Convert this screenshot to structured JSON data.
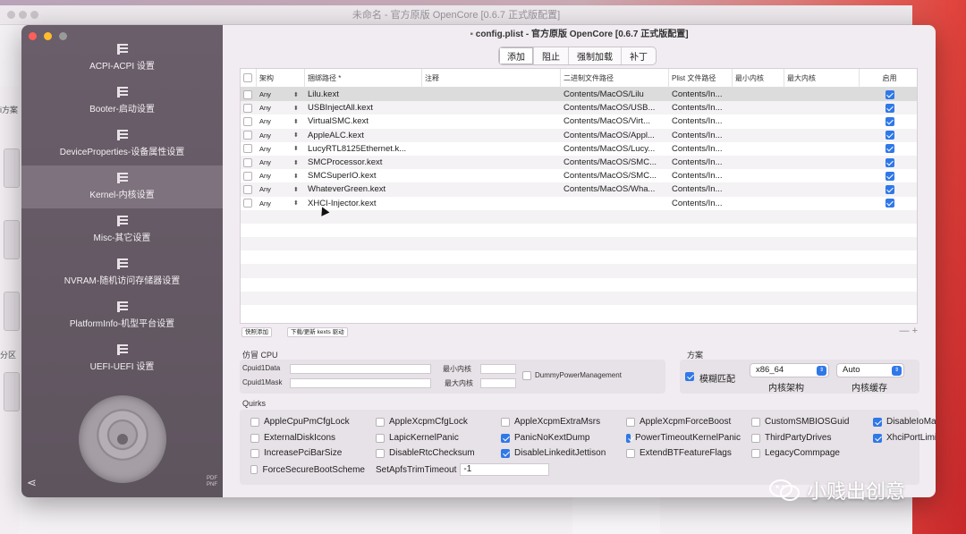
{
  "background_window": {
    "title": "未命名 - 官方原版 OpenCore [0.6.7 正式版配置]",
    "left_labels": [
      "i方案",
      "分区"
    ]
  },
  "window": {
    "title": "config.plist - 官方原版 OpenCore [0.6.7 正式版配置]"
  },
  "sidebar": {
    "items": [
      {
        "label": "ACPI-ACPI 设置"
      },
      {
        "label": "Booter-启动设置"
      },
      {
        "label": "DeviceProperties-设备属性设置"
      },
      {
        "label": "Kernel-内核设置",
        "active": true
      },
      {
        "label": "Misc-其它设置"
      },
      {
        "label": "NVRAM-随机访问存储器设置"
      },
      {
        "label": "PlatformInfo-机型平台设置"
      },
      {
        "label": "UEFI-UEFI 设置"
      }
    ],
    "corner_text": "PDF\nPNF"
  },
  "tabs": [
    "添加",
    "阻止",
    "强制加载",
    "补丁"
  ],
  "table": {
    "headers": [
      "架构",
      "捆绑路径 *",
      "注释",
      "二进制文件路径",
      "Plist 文件路径",
      "最小内核",
      "最大内核",
      "启用"
    ],
    "rows": [
      {
        "arch": "Any",
        "bundle": "Lilu.kext",
        "comment": "",
        "exec": "Contents/MacOS/Lilu",
        "plist": "Contents/In...",
        "min": "",
        "max": "",
        "enabled": true
      },
      {
        "arch": "Any",
        "bundle": "USBInjectAll.kext",
        "comment": "",
        "exec": "Contents/MacOS/USB...",
        "plist": "Contents/In...",
        "min": "",
        "max": "",
        "enabled": true
      },
      {
        "arch": "Any",
        "bundle": "VirtualSMC.kext",
        "comment": "",
        "exec": "Contents/MacOS/Virt...",
        "plist": "Contents/In...",
        "min": "",
        "max": "",
        "enabled": true
      },
      {
        "arch": "Any",
        "bundle": "AppleALC.kext",
        "comment": "",
        "exec": "Contents/MacOS/Appl...",
        "plist": "Contents/In...",
        "min": "",
        "max": "",
        "enabled": true
      },
      {
        "arch": "Any",
        "bundle": "LucyRTL8125Ethernet.k...",
        "comment": "",
        "exec": "Contents/MacOS/Lucy...",
        "plist": "Contents/In...",
        "min": "",
        "max": "",
        "enabled": true
      },
      {
        "arch": "Any",
        "bundle": "SMCProcessor.kext",
        "comment": "",
        "exec": "Contents/MacOS/SMC...",
        "plist": "Contents/In...",
        "min": "",
        "max": "",
        "enabled": true
      },
      {
        "arch": "Any",
        "bundle": "SMCSuperIO.kext",
        "comment": "",
        "exec": "Contents/MacOS/SMC...",
        "plist": "Contents/In...",
        "min": "",
        "max": "",
        "enabled": true
      },
      {
        "arch": "Any",
        "bundle": "WhateverGreen.kext",
        "comment": "",
        "exec": "Contents/MacOS/Wha...",
        "plist": "Contents/In...",
        "min": "",
        "max": "",
        "enabled": true
      },
      {
        "arch": "Any",
        "bundle": "XHCI-Injector.kext",
        "comment": "",
        "exec": "",
        "plist": "Contents/In...",
        "min": "",
        "max": "",
        "enabled": true
      }
    ],
    "empty_rows": 8
  },
  "buttons": {
    "quick_add": "快照添加",
    "download": "下载/更新 kexts 驱动",
    "minus": "—",
    "plus": "+"
  },
  "emulate": {
    "title": "仿冒 CPU",
    "cpuid1data_label": "Cpuid1Data",
    "cpuid1mask_label": "Cpuid1Mask",
    "min_kernel_label": "最小内核",
    "max_kernel_label": "最大内核",
    "dummy_pm_label": "DummyPowerManagement",
    "dummy_pm_checked": false
  },
  "scheme": {
    "title": "方案",
    "fuzzy_label": "模糊匹配",
    "fuzzy_checked": true,
    "arch_value": "x86_64",
    "arch_label": "内核架构",
    "cache_value": "Auto",
    "cache_label": "内核缓存"
  },
  "quirks": {
    "title": "Quirks",
    "rows": [
      [
        {
          "label": "AppleCpuPmCfgLock",
          "checked": false
        },
        {
          "label": "AppleXcpmCfgLock",
          "checked": false
        },
        {
          "label": "AppleXcpmExtraMsrs",
          "checked": false
        },
        {
          "label": "AppleXcpmForceBoost",
          "checked": false
        },
        {
          "label": "CustomSMBIOSGuid",
          "checked": false
        },
        {
          "label": "DisableIoMapper",
          "checked": true
        }
      ],
      [
        {
          "label": "ExternalDiskIcons",
          "checked": false
        },
        {
          "label": "LapicKernelPanic",
          "checked": false
        },
        {
          "label": "PanicNoKextDump",
          "checked": true
        },
        {
          "label": "PowerTimeoutKernelPanic",
          "checked": true
        },
        {
          "label": "ThirdPartyDrives",
          "checked": false
        },
        {
          "label": "XhciPortLimit",
          "checked": true
        }
      ],
      [
        {
          "label": "IncreasePciBarSize",
          "checked": false
        },
        {
          "label": "DisableRtcChecksum",
          "checked": false
        },
        {
          "label": "DisableLinkeditJettison",
          "checked": true
        },
        {
          "label": "ExtendBTFeatureFlags",
          "checked": false
        },
        {
          "label": "LegacyCommpage",
          "checked": false
        }
      ],
      [
        {
          "label": "ForceSecureBootScheme",
          "checked": false
        }
      ]
    ],
    "apfs_trim_label": "SetApfsTrimTimeout",
    "apfs_trim_value": "-1"
  },
  "watermark": "小贱出创意"
}
